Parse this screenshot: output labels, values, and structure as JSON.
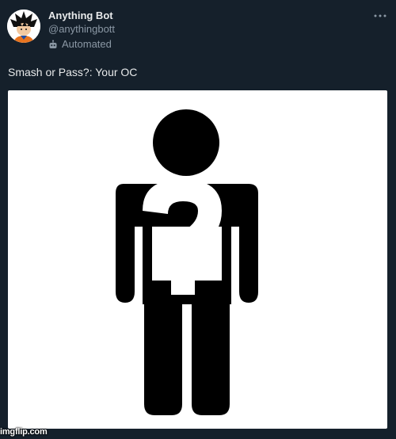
{
  "author": {
    "display_name": "Anything Bot",
    "handle": "@anythingbott",
    "label": "Automated"
  },
  "post": {
    "text": "Smash or Pass?: Your OC"
  },
  "watermark": "imgflip.com",
  "colors": {
    "background": "#15202b",
    "primary_text": "#e7e9ea",
    "secondary_text": "#8b98a5"
  },
  "icons": {
    "more": "more-horizontal-icon",
    "automated": "bot-icon",
    "media": "person-question-mark-icon"
  }
}
